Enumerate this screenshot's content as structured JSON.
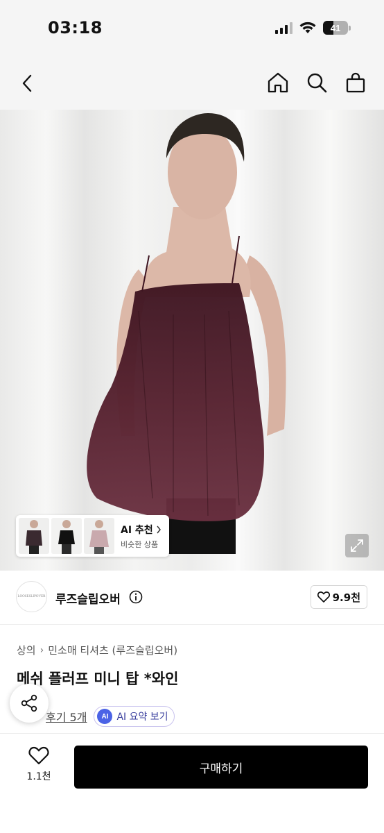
{
  "status": {
    "time": "03:18",
    "battery": "41",
    "battery_level": 0.41
  },
  "nav": {
    "back_icon": "chevron-left-icon",
    "icons": [
      "home-icon",
      "search-icon",
      "shopping-bag-icon"
    ]
  },
  "ai_recommendation": {
    "title": "AI 추천",
    "subtitle": "비슷한 상품"
  },
  "store": {
    "logo_text": "LOOSESLIPOVER",
    "name": "루즈슬립오버",
    "likes": "9.9천"
  },
  "breadcrumb": [
    "상의",
    "민소매 티셔츠 (루즈슬립오버)"
  ],
  "product": {
    "title": "메쉬 플러프 미니 탑 *와인"
  },
  "reviews": {
    "link_label": "후기 5개",
    "ai_badge": "AI",
    "ai_summary_label": "AI 요약 보기"
  },
  "bottom_bar": {
    "wish_count": "1.1천",
    "buy_label": "구매하기"
  },
  "colors": {
    "buy_button": "#000000",
    "ai_accent": "#4b63e6",
    "garment": "#4a1a26"
  }
}
